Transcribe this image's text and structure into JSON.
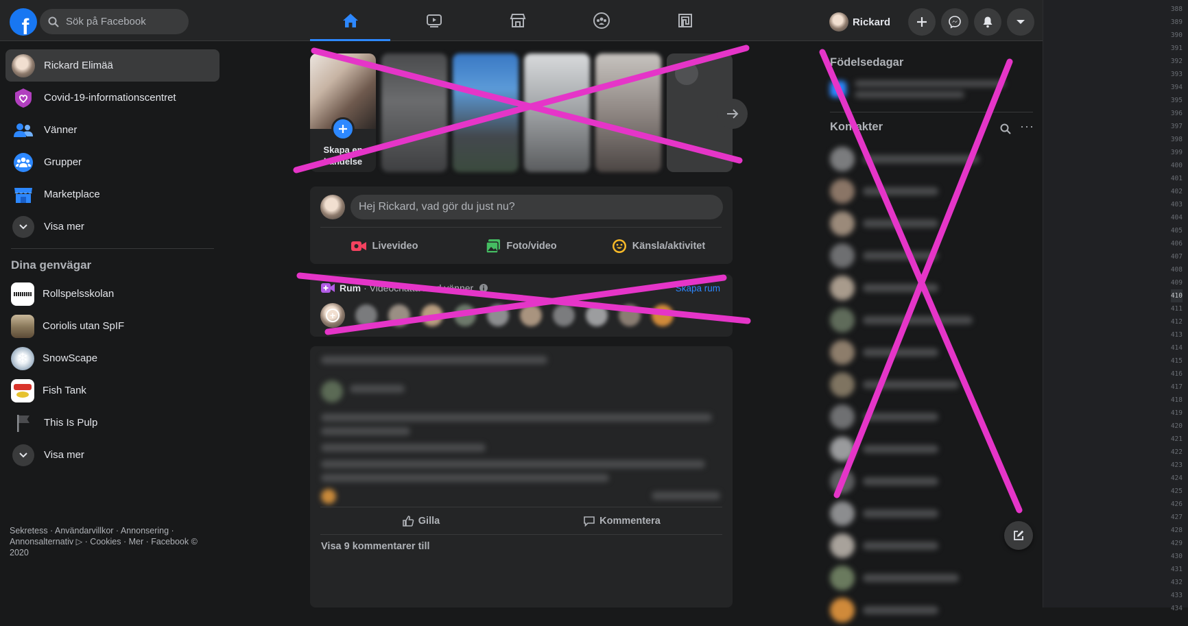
{
  "header": {
    "search_placeholder": "Sök på Facebook",
    "profile_name": "Rickard",
    "nav_tabs": [
      {
        "name": "home",
        "active": true
      },
      {
        "name": "watch",
        "active": false
      },
      {
        "name": "marketplace",
        "active": false
      },
      {
        "name": "groups",
        "active": false
      },
      {
        "name": "gaming",
        "active": false
      }
    ],
    "right_buttons": [
      "plus-icon",
      "messenger-icon",
      "notifications-icon",
      "account-menu-icon"
    ]
  },
  "sidebar": {
    "items": [
      {
        "label": "Rickard Elimää",
        "icon": "profile-avatar"
      },
      {
        "label": "Covid-19-informationscentret",
        "icon": "covid-icon"
      },
      {
        "label": "Vänner",
        "icon": "friends-icon"
      },
      {
        "label": "Grupper",
        "icon": "groups-icon"
      },
      {
        "label": "Marketplace",
        "icon": "marketplace-icon"
      },
      {
        "label": "Visa mer",
        "icon": "chevron-down-icon"
      }
    ],
    "shortcuts_title": "Dina genvägar",
    "shortcuts": [
      {
        "label": "Rollspelsskolan"
      },
      {
        "label": "Coriolis utan SpIF"
      },
      {
        "label": "SnowScape"
      },
      {
        "label": "Fish Tank"
      },
      {
        "label": "This Is Pulp"
      },
      {
        "label": "Visa mer"
      }
    ],
    "footer": "Sekretess · Användarvillkor · Annonsering · Annonsalternativ ▷ · Cookies · Mer · Facebook © 2020"
  },
  "stories": {
    "create_label_line1": "Skapa en",
    "create_label_line2": "händelse"
  },
  "composer": {
    "prompt": "Hej Rickard, vad gör du just nu?",
    "actions": {
      "live": "Livevideo",
      "photo": "Foto/video",
      "feeling": "Känsla/aktivitet"
    }
  },
  "rooms": {
    "title": "Rum",
    "subtitle": "· Videochatta med vänner",
    "create_label": "Skapa rum"
  },
  "post": {
    "like": "Gilla",
    "comment": "Kommentera",
    "more_comments": "Visa 9 kommentarer till"
  },
  "right_column": {
    "birthdays_title": "Födelsedagar",
    "contacts_title": "Kontakter"
  },
  "line_numbers": {
    "values": [
      "388",
      "389",
      "390",
      "391",
      "392",
      "393",
      "394",
      "395",
      "396",
      "397",
      "398",
      "399",
      "400",
      "401",
      "402",
      "403",
      "404",
      "405",
      "406",
      "407",
      "408",
      "409",
      "410",
      "411",
      "412",
      "413",
      "414",
      "415",
      "416",
      "417",
      "418",
      "419",
      "420",
      "421",
      "422",
      "423",
      "424",
      "425",
      "426",
      "427",
      "428",
      "429",
      "430",
      "431",
      "432",
      "433",
      "434"
    ],
    "current": "410"
  },
  "colors": {
    "accent": "#2d88ff",
    "background": "#18191a",
    "surface": "#242526",
    "overlay_x": "#e535c8"
  }
}
